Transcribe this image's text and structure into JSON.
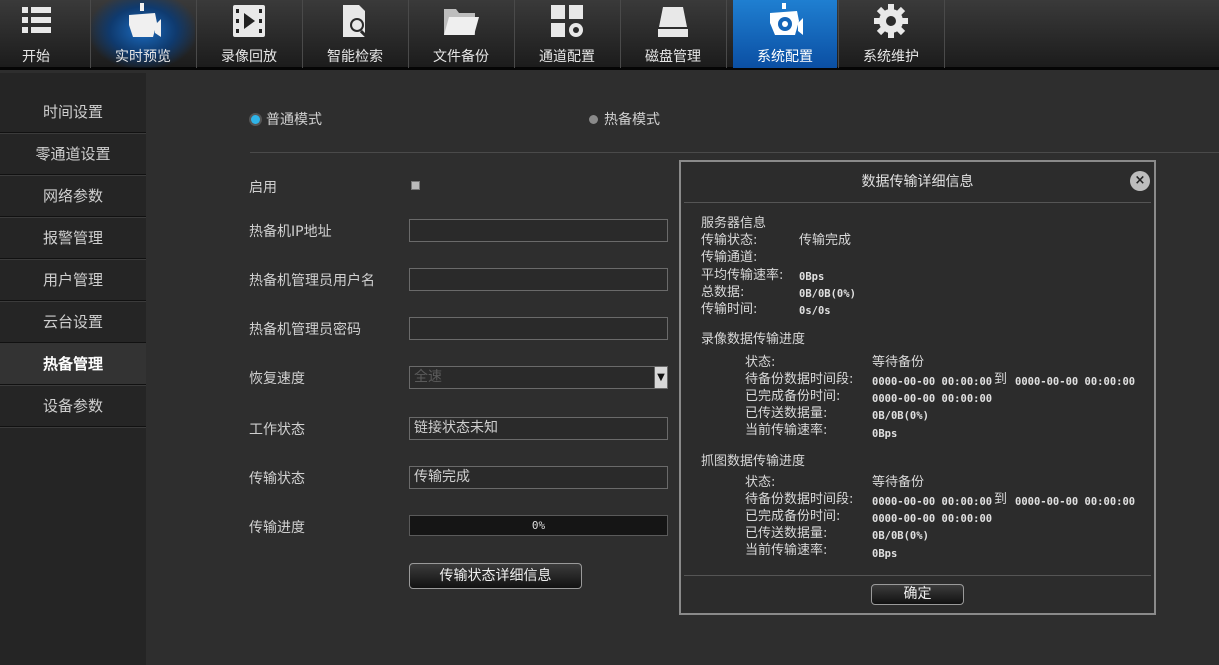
{
  "toolbar": {
    "items": [
      {
        "label": "开始",
        "icon": "list-icon"
      },
      {
        "label": "实时预览",
        "icon": "camera-icon"
      },
      {
        "label": "录像回放",
        "icon": "play-film-icon"
      },
      {
        "label": "智能检索",
        "icon": "doc-search-icon"
      },
      {
        "label": "文件备份",
        "icon": "folder-icon"
      },
      {
        "label": "通道配置",
        "icon": "grid-gear-icon"
      },
      {
        "label": "磁盘管理",
        "icon": "disk-icon"
      },
      {
        "label": "系统配置",
        "icon": "camera-gear-icon"
      },
      {
        "label": "系统维护",
        "icon": "gear-icon"
      }
    ]
  },
  "sidebar": {
    "items": [
      {
        "label": "时间设置"
      },
      {
        "label": "零通道设置"
      },
      {
        "label": "网络参数"
      },
      {
        "label": "报警管理"
      },
      {
        "label": "用户管理"
      },
      {
        "label": "云台设置"
      },
      {
        "label": "热备管理"
      },
      {
        "label": "设备参数"
      }
    ]
  },
  "mode": {
    "normal": "普通模式",
    "hot_standby": "热备模式"
  },
  "form": {
    "enable_label": "启用",
    "ip_label": "热备机IP地址",
    "ip_value": "",
    "user_label": "热备机管理员用户名",
    "user_value": "",
    "password_label": "热备机管理员密码",
    "password_value": "",
    "speed_label": "恢复速度",
    "speed_value": "全速",
    "work_status_label": "工作状态",
    "work_status_value": "链接状态未知",
    "transfer_status_label": "传输状态",
    "transfer_status_value": "传输完成",
    "progress_label": "传输进度",
    "progress_value": "0%",
    "detail_button": "传输状态详细信息"
  },
  "dialog": {
    "title": "数据传输详细信息",
    "server_title": "服务器信息",
    "status_label": "传输状态:",
    "status_value": "传输完成",
    "channel_label": "传输通道:",
    "avg_rate_label": "平均传输速率:",
    "avg_rate_value": "0Bps",
    "total_label": "总数据:",
    "total_value": "0B/0B(0%)",
    "time_label": "传输时间:",
    "time_value": "0s/0s",
    "record": {
      "title": "录像数据传输进度",
      "state_label": "状态:",
      "state_value": "等待备份",
      "pending_label": "待备份数据时间段:",
      "pending_from": "0000-00-00 00:00:00",
      "to": "到",
      "pending_to": "0000-00-00 00:00:00",
      "done_label": "已完成备份时间:",
      "done_value": "0000-00-00 00:00:00",
      "sent_label": "已传送数据量:",
      "sent_value": "0B/0B(0%)",
      "rate_label": "当前传输速率:",
      "rate_value": "0Bps"
    },
    "capture": {
      "title": "抓图数据传输进度",
      "state_label": "状态:",
      "state_value": "等待备份",
      "pending_label": "待备份数据时间段:",
      "pending_from": "0000-00-00 00:00:00",
      "to": "到",
      "pending_to": "0000-00-00 00:00:00",
      "done_label": "已完成备份时间:",
      "done_value": "0000-00-00 00:00:00",
      "sent_label": "已传送数据量:",
      "sent_value": "0B/0B(0%)",
      "rate_label": "当前传输速率:",
      "rate_value": "0Bps"
    },
    "ok_button": "确定",
    "close": "×"
  },
  "colors": {
    "active_blue": "#1f7fd1",
    "radio_on": "#2fb4e8"
  }
}
